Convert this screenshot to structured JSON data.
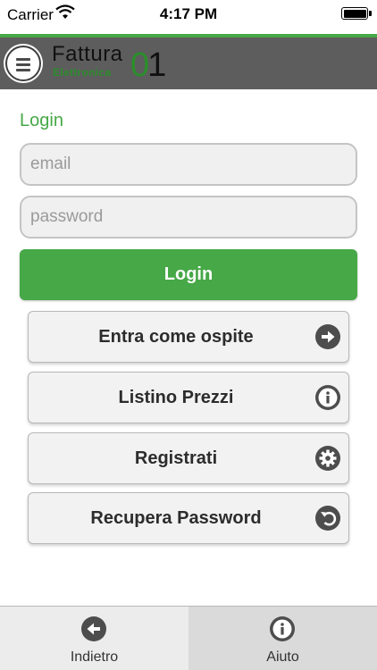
{
  "status_bar": {
    "carrier": "Carrier",
    "time": "4:17 PM"
  },
  "header": {
    "logo_word1": "Fattura",
    "logo_word2": "Elettronica",
    "logo_digit0": "0",
    "logo_digit1": "1"
  },
  "login": {
    "title": "Login",
    "email_placeholder": "email",
    "password_placeholder": "password",
    "submit_label": "Login"
  },
  "actions": [
    {
      "label": "Entra come ospite",
      "icon": "arrow-right-icon"
    },
    {
      "label": "Listino Prezzi",
      "icon": "info-icon"
    },
    {
      "label": "Registrati",
      "icon": "gear-icon"
    },
    {
      "label": "Recupera Password",
      "icon": "undo-icon"
    }
  ],
  "tab_bar": {
    "items": [
      {
        "label": "Indietro",
        "icon": "arrow-left-icon"
      },
      {
        "label": "Aiuto",
        "icon": "info-icon"
      }
    ]
  },
  "colors": {
    "accent": "#46a846",
    "header_bg": "#5d5d5d",
    "icon_dark": "#4d4d4d"
  }
}
